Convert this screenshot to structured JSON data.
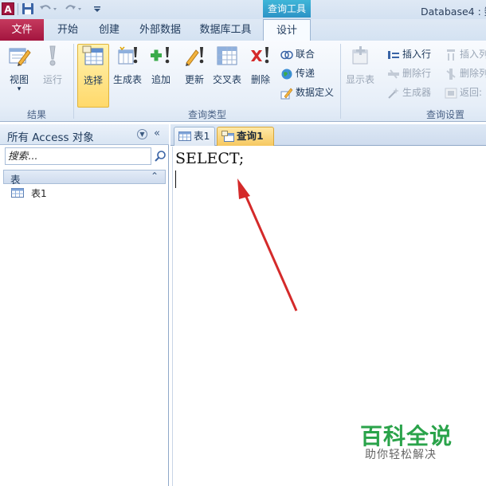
{
  "titlebar": {
    "app_icon": "A",
    "title": "Database4 : 数",
    "contextual_tab_group": "查询工具",
    "quick_access": {
      "save_icon": "save-icon",
      "undo_icon": "undo-icon",
      "redo_icon": "redo-icon",
      "customize_icon": "dropdown-icon"
    }
  },
  "ribbon_tabs": [
    {
      "label": "文件"
    },
    {
      "label": "开始"
    },
    {
      "label": "创建"
    },
    {
      "label": "外部数据"
    },
    {
      "label": "数据库工具"
    },
    {
      "label": "设计"
    }
  ],
  "ribbon": {
    "groups": {
      "results": "结果",
      "query_type": "查询类型",
      "query_setup": "查询设置"
    },
    "results": {
      "view": "视图",
      "run": "运行"
    },
    "query_type": {
      "select": "选择",
      "make_table": "生成表",
      "append": "追加",
      "update": "更新",
      "crosstab": "交叉表",
      "delete": "删除",
      "union": "联合",
      "pass_through": "传递",
      "data_definition": "数据定义"
    },
    "query_setup": {
      "show_table": "显示表",
      "insert_rows": "插入行",
      "delete_rows": "删除行",
      "builder": "生成器",
      "insert_columns": "插入列",
      "delete_columns": "删除列",
      "return": "返回:"
    }
  },
  "nav_pane": {
    "title": "所有 Access 对象",
    "search_placeholder": "搜索...",
    "group": "表",
    "items": [
      {
        "label": "表1"
      }
    ]
  },
  "document": {
    "tabs": [
      {
        "label": "表1"
      },
      {
        "label": "查询1"
      }
    ],
    "sql_text": "SELECT;"
  },
  "watermark": {
    "title": "百科全说",
    "subtitle": "助你轻松解决"
  },
  "colors": {
    "file_tab": "#a3153f",
    "accent": "#2b579a",
    "arrow": "#d42a2a",
    "selected_button": "#ffd96b"
  }
}
